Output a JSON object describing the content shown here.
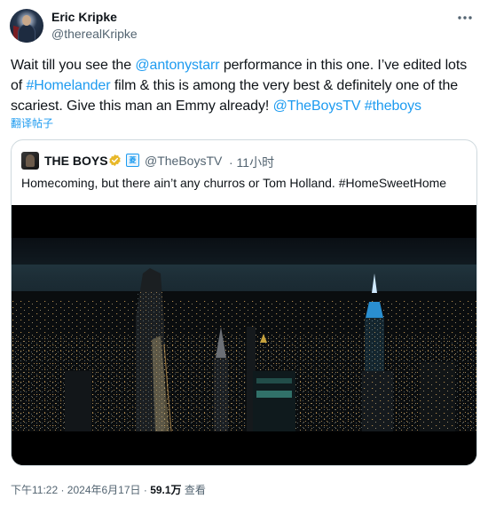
{
  "author": {
    "name": "Eric Kripke",
    "handle": "@therealKripke"
  },
  "tweet": {
    "segments": [
      {
        "text": "Wait till you see the ",
        "link": false
      },
      {
        "text": "@antonystarr",
        "link": true
      },
      {
        "text": " performance in this one. I’ve edited lots of ",
        "link": false
      },
      {
        "text": "#Homelander",
        "link": true
      },
      {
        "text": " film & this is among the very best & definitely one of the scariest. Give this man an Emmy already! ",
        "link": false
      },
      {
        "text": "@TheBoysTV",
        "link": true
      },
      {
        "text": " ",
        "link": false
      },
      {
        "text": "#theboys",
        "link": true
      }
    ],
    "translate_label": "翻译帖子"
  },
  "quote": {
    "name": "THE BOYS",
    "handle": "@TheBoysTV",
    "time": "· 11小时",
    "affiliate_glyph": "菱",
    "text": "Homecoming, but there ain’t any churros or Tom Holland. #HomeSweetHome"
  },
  "meta": {
    "time": "下午11:22 · 2024年6月17日 · ",
    "views_count": "59.1万",
    "views_label": " 查看"
  },
  "colors": {
    "link": "#1d9bf0",
    "secondary_text": "#536471",
    "verified_badge": "#e8b829",
    "border": "#cfd9de"
  },
  "icons": {
    "more": "more-horizontal-icon",
    "verified": "verified-badge-icon",
    "affiliate": "affiliate-badge-icon"
  }
}
